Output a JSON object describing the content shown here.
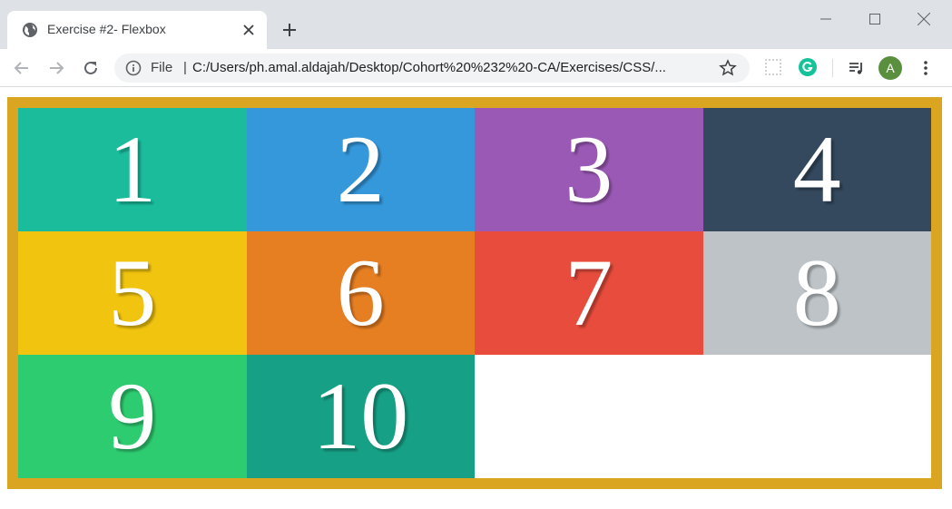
{
  "browser": {
    "tab_title": "Exercise #2- Flexbox",
    "omnibox": {
      "scheme_label": "File",
      "separator": "|",
      "url": "C:/Users/ph.amal.aldajah/Desktop/Cohort%20%232%20-CA/Exercises/CSS/..."
    },
    "avatar_letter": "A"
  },
  "page": {
    "border_color": "#daa520",
    "boxes": [
      {
        "label": "1",
        "color": "#1abc9c"
      },
      {
        "label": "2",
        "color": "#3498db"
      },
      {
        "label": "3",
        "color": "#9b59b6"
      },
      {
        "label": "4",
        "color": "#34495e"
      },
      {
        "label": "5",
        "color": "#f1c40f"
      },
      {
        "label": "6",
        "color": "#e67e22"
      },
      {
        "label": "7",
        "color": "#e74c3c"
      },
      {
        "label": "8",
        "color": "#bdc3c7"
      },
      {
        "label": "9",
        "color": "#2ecc71"
      },
      {
        "label": "10",
        "color": "#16a085"
      }
    ]
  }
}
